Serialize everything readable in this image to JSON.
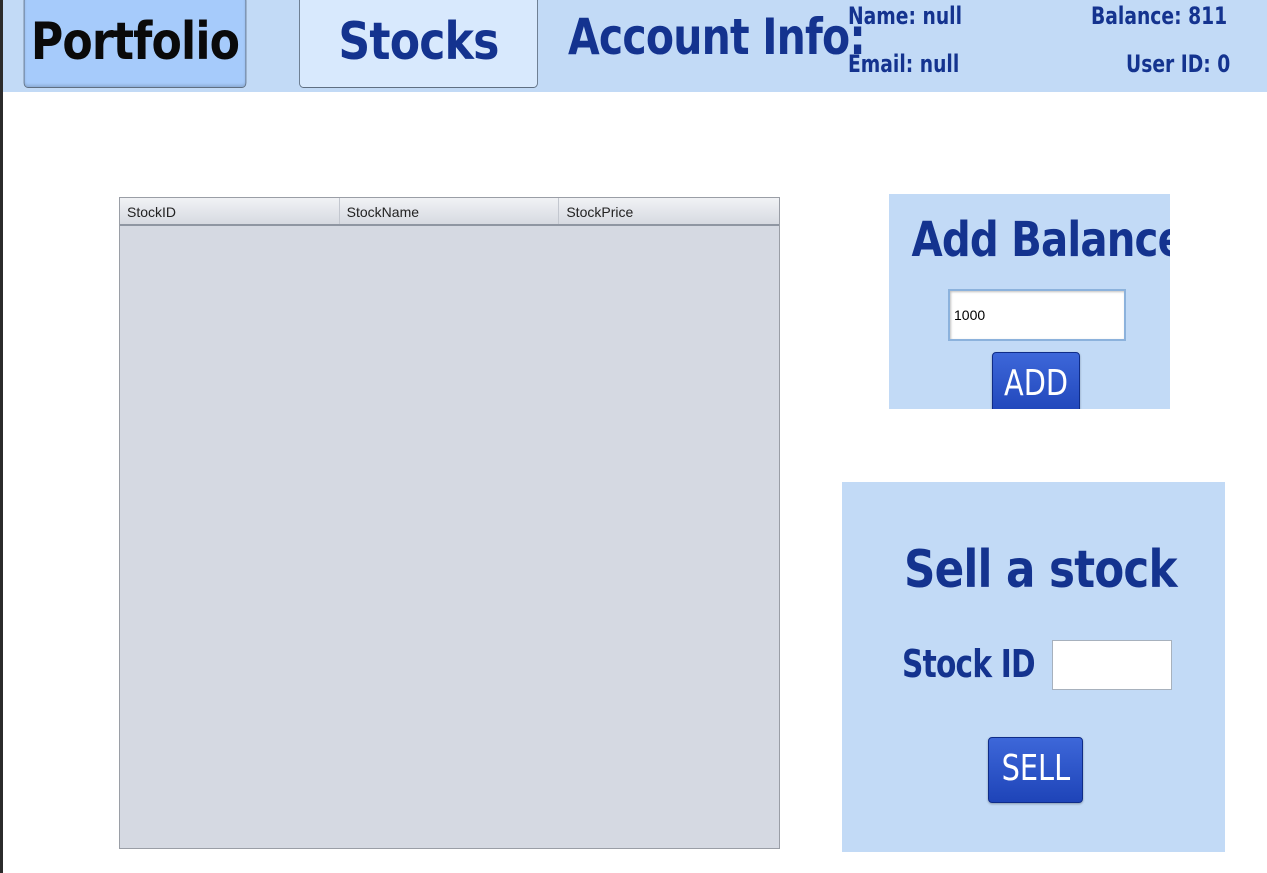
{
  "nav": {
    "portfolio_label": "Portfolio",
    "stocks_label": "Stocks"
  },
  "account": {
    "title": "Account Info:",
    "name": "Name: null",
    "email": "Email: null",
    "balance": "Balance: 811",
    "user_id": "User ID: 0"
  },
  "table": {
    "columns": [
      "StockID",
      "StockName",
      "StockPrice"
    ],
    "rows": []
  },
  "add_balance": {
    "title": "Add Balance",
    "input_value": "1000",
    "button_label": "ADD"
  },
  "sell": {
    "title": "Sell a stock",
    "stock_id_label": "Stock ID",
    "stock_id_value": "",
    "button_label": "SELL"
  },
  "colors": {
    "panel_bg": "#c2daf6",
    "heading_text": "#14338f",
    "button_blue": "#2a50c8",
    "active_tab": "#a6cbfb",
    "table_bg": "#d5d9e2"
  }
}
